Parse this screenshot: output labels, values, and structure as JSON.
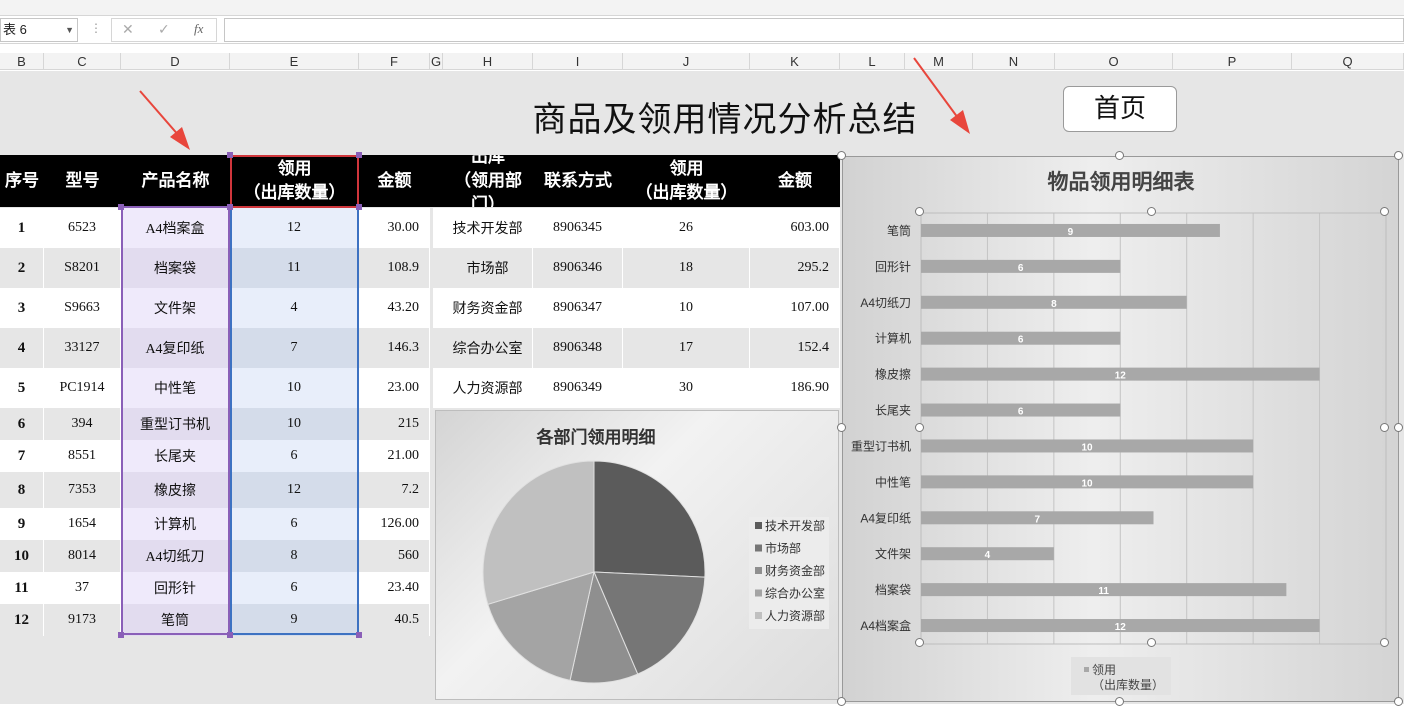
{
  "toolbar": {
    "namebox": "表 6",
    "fx": "fx",
    "cancel": "✕",
    "confirm": "✓"
  },
  "columns": [
    "B",
    "C",
    "D",
    "E",
    "F",
    "G",
    "H",
    "I",
    "J",
    "K",
    "L",
    "M",
    "N",
    "O",
    "P",
    "Q"
  ],
  "title": "商品及领用情况分析总结",
  "home_button": "首页",
  "left_table": {
    "headers": [
      "序号",
      "型号",
      "产品名称",
      "领用\n（出库数量）",
      "金额"
    ],
    "rows": [
      [
        "1",
        "6523",
        "A4档案盒",
        "12",
        "30.00"
      ],
      [
        "2",
        "S8201",
        "档案袋",
        "11",
        "108.9"
      ],
      [
        "3",
        "S9663",
        "文件架",
        "4",
        "43.20"
      ],
      [
        "4",
        "33127",
        "A4复印纸",
        "7",
        "146.3"
      ],
      [
        "5",
        "PC1914",
        "中性笔",
        "10",
        "23.00"
      ],
      [
        "6",
        "394",
        "重型订书机",
        "10",
        "215"
      ],
      [
        "7",
        "8551",
        "长尾夹",
        "6",
        "21.00"
      ],
      [
        "8",
        "7353",
        "橡皮擦",
        "12",
        "7.2"
      ],
      [
        "9",
        "1654",
        "计算机",
        "6",
        "126.00"
      ],
      [
        "10",
        "8014",
        "A4切纸刀",
        "8",
        "560"
      ],
      [
        "11",
        "37",
        "回形针",
        "6",
        "23.40"
      ],
      [
        "12",
        "9173",
        "笔筒",
        "9",
        "40.5"
      ]
    ]
  },
  "right_table": {
    "headers": [
      "出库\n（领用部\n门）",
      "联系方式",
      "领用\n（出库数量）",
      "金额"
    ],
    "rows": [
      [
        "技术开发部",
        "8906345",
        "26",
        "603.00"
      ],
      [
        "市场部",
        "8906346",
        "18",
        "295.2"
      ],
      [
        "财务资金部",
        "8906347",
        "10",
        "107.00"
      ],
      [
        "综合办公室",
        "8906348",
        "17",
        "152.4"
      ],
      [
        "人力资源部",
        "8906349",
        "30",
        "186.90"
      ]
    ]
  },
  "chart_data": [
    {
      "type": "pie",
      "title": "各部门领用明细",
      "categories": [
        "技术开发部",
        "市场部",
        "财务资金部",
        "综合办公室",
        "人力资源部"
      ],
      "values": [
        26,
        18,
        10,
        17,
        30
      ],
      "legend": "right",
      "colors": [
        "#5b5b5b",
        "#767676",
        "#8f8f8f",
        "#a4a4a4",
        "#c0c0c0"
      ]
    },
    {
      "type": "bar",
      "orientation": "horizontal",
      "title": "物品领用明细表",
      "categories": [
        "笔筒",
        "回形针",
        "A4切纸刀",
        "计算机",
        "橡皮擦",
        "长尾夹",
        "重型订书机",
        "中性笔",
        "A4复印纸",
        "文件架",
        "档案袋",
        "A4档案盒"
      ],
      "series": [
        {
          "name": "领用\n（出库数量）",
          "values": [
            9,
            6,
            8,
            6,
            12,
            6,
            10,
            10,
            7,
            4,
            11,
            12
          ]
        }
      ],
      "xlim": [
        0,
        14
      ],
      "grid": true,
      "legend": "bottom",
      "color": "#a8a8a8"
    }
  ]
}
